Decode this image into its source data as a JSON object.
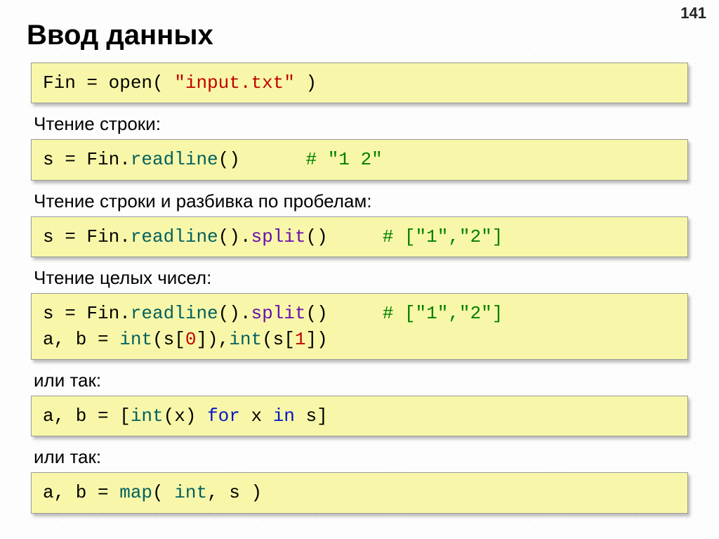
{
  "page_number": "141",
  "title": "Ввод данных",
  "code1": {
    "t1": "Fin = open( ",
    "t2": "\"input.txt\"",
    "t3": " )"
  },
  "label1": "Чтение строки:",
  "code2": {
    "t1": "s = Fin.",
    "t2": "readline",
    "t3": "()      ",
    "t4": "# \"1 2\""
  },
  "label2": "Чтение строки и разбивка по пробелам:",
  "code3": {
    "t1": "s = Fin.",
    "t2": "readline",
    "t3": "().",
    "t4": "split",
    "t5": "()     ",
    "t6": "# [\"1\",\"2\"]"
  },
  "label3": "Чтение целых чисел:",
  "code4": {
    "l1a": "s = Fin.",
    "l1b": "readline",
    "l1c": "().",
    "l1d": "split",
    "l1e": "()     ",
    "l1f": "# [\"1\",\"2\"]",
    "l2a": "a, b = ",
    "l2b": "int",
    "l2c": "(s[",
    "l2d": "0",
    "l2e": "]),",
    "l2f": "int",
    "l2g": "(s[",
    "l2h": "1",
    "l2i": "])"
  },
  "label4": "или так:",
  "code5": {
    "t1": "a, b = [",
    "t2": "int",
    "t3": "(x) ",
    "t4": "for",
    "t5": " x ",
    "t6": "in",
    "t7": " s]"
  },
  "label5": "или так:",
  "code6": {
    "t1": "a, b = ",
    "t2": "map",
    "t3": "( ",
    "t4": "int",
    "t5": ", s )"
  }
}
